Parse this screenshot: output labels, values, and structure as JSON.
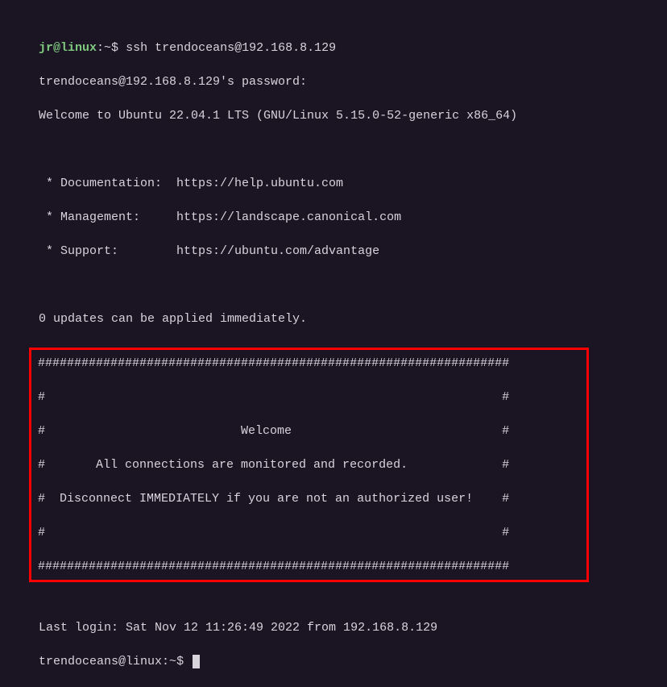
{
  "prompt1": {
    "user": "jr@linux",
    "sep": ":",
    "path": "~",
    "symbol": "$",
    "command": "ssh trendoceans@192.168.8.129"
  },
  "password_prompt": "trendoceans@192.168.8.129's password:",
  "welcome": "Welcome to Ubuntu 22.04.1 LTS (GNU/Linux 5.15.0-52-generic x86_64)",
  "links": {
    "doc": " * Documentation:  https://help.ubuntu.com",
    "mgmt": " * Management:     https://landscape.canonical.com",
    "support": " * Support:        https://ubuntu.com/advantage"
  },
  "updates": "0 updates can be applied immediately.",
  "banner": {
    "border": "#################################################################",
    "empty": "#                                                               #",
    "l1": "#                           Welcome                             #",
    "l2": "#       All connections are monitored and recorded.             #",
    "l3": "#  Disconnect IMMEDIATELY if you are not an authorized user!    #"
  },
  "last_login": "Last login: Sat Nov 12 11:26:49 2022 from 192.168.8.129",
  "prompt2": {
    "user": "trendoceans@linux",
    "sep": ":",
    "path": "~",
    "symbol": "$"
  }
}
